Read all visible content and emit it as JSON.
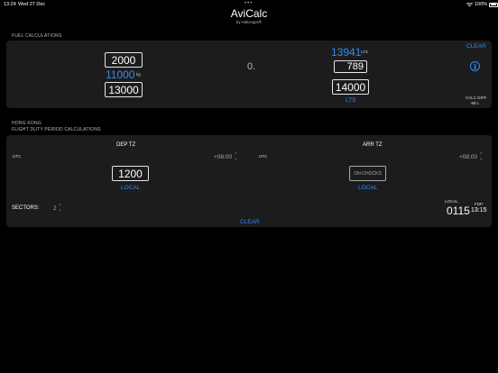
{
  "status": {
    "time": "13:24",
    "date": "Wed 27 Dec",
    "battery": "100%"
  },
  "app": {
    "title": "AviCalc",
    "subtitle": "by AldoApps®"
  },
  "fuel": {
    "section_label": "FUEL CALCULATIONS",
    "left_top": "2000",
    "left_kg": "11000",
    "kg_unit": "kg",
    "left_bottom": "13000",
    "center_value": "0.",
    "lts_value": "13941",
    "lts_unit": "LTS",
    "right_mid": "789",
    "right_bottom": "14000",
    "right_unit_label": "LTS",
    "clear_label": "CLEAR",
    "calc_diff_label": "CALC DIFF",
    "calc_diff_value": "-59 L"
  },
  "fdp": {
    "location": "HONG KONG",
    "section_label": "FLIGHT DUTY PERIOD CALCULATIONS",
    "dep_tz_label": "DEP TZ",
    "arr_tz_label": "ARR TZ",
    "dep_utc_label": "UTC",
    "dep_offset": "+08:00",
    "arr_utc_label": "UTC",
    "arr_offset": "+08:00",
    "dep_time": "1200",
    "dep_local_label": "LOCAL",
    "arr_button": "ON-CHOCKS",
    "arr_local_label": "LOCAL",
    "sectors_label": "SECTORS:",
    "sectors_value": "2",
    "local_label": "LOCAL",
    "local_value": "0115",
    "fdp_label": "FDP",
    "fdp_value": "13:15",
    "clear_label": "CLEAR"
  },
  "colors": {
    "accent": "#2f8df5",
    "panel": "#1c1c1e",
    "background": "#000000"
  }
}
